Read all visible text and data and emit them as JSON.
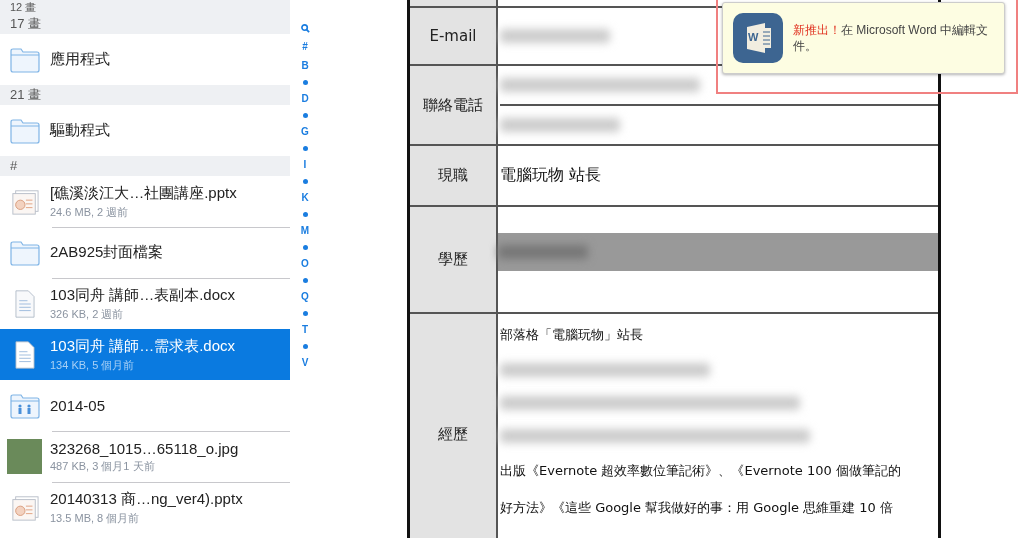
{
  "file_list": [
    {
      "kind": "header",
      "title": "12 畫"
    },
    {
      "kind": "header",
      "title": "17 畫"
    },
    {
      "kind": "folder",
      "name": "應用程式",
      "selected": false
    },
    {
      "kind": "header",
      "title": "21 畫"
    },
    {
      "kind": "folder",
      "name": "驅動程式",
      "selected": false
    },
    {
      "kind": "header",
      "title": "#"
    },
    {
      "kind": "pptx",
      "name": "[礁溪淡江大…社團講座.pptx",
      "meta": "24.6 MB, 2 週前",
      "selected": false
    },
    {
      "kind": "folder",
      "name": "2AB925封面檔案",
      "selected": false
    },
    {
      "kind": "docx",
      "name": "103同舟 講師…表副本.docx",
      "meta": "326 KB, 2 週前",
      "selected": false
    },
    {
      "kind": "docx",
      "name": "103同舟 講師…需求表.docx",
      "meta": "134 KB, 5 個月前",
      "selected": true
    },
    {
      "kind": "shared",
      "name": "2014-05",
      "selected": false
    },
    {
      "kind": "photo",
      "name": "323268_1015…65118_o.jpg",
      "meta": "487 KB, 3 個月1 天前",
      "selected": false
    },
    {
      "kind": "pptx",
      "name": "20140313 商…ng_ver4).pptx",
      "meta": "13.5 MB, 8 個月前",
      "selected": false
    }
  ],
  "index_bar": [
    "#",
    "B",
    "D",
    "G",
    "I",
    "K",
    "M",
    "O",
    "Q",
    "T",
    "V"
  ],
  "document": {
    "rows": [
      {
        "kind": "email",
        "label": "E-mail"
      },
      {
        "kind": "phone",
        "label": "聯絡電話"
      },
      {
        "kind": "text",
        "label": "現職",
        "lines": [
          "電腦玩物  站長"
        ]
      },
      {
        "kind": "education",
        "label": "學歷"
      },
      {
        "kind": "experience",
        "label": "經歷",
        "lines": [
          "部落格「電腦玩物」站長",
          "出版《Evernote 超效率數位筆記術》、《Evernote 100 個做筆記的",
          "好方法》《這些 Google 幫我做好的事：用 Google 思維重建 10 倍"
        ]
      }
    ]
  },
  "tip": {
    "icon_letter": "W",
    "highlight": "新推出！",
    "text": "在 Microsoft Word 中編輯文件。"
  }
}
